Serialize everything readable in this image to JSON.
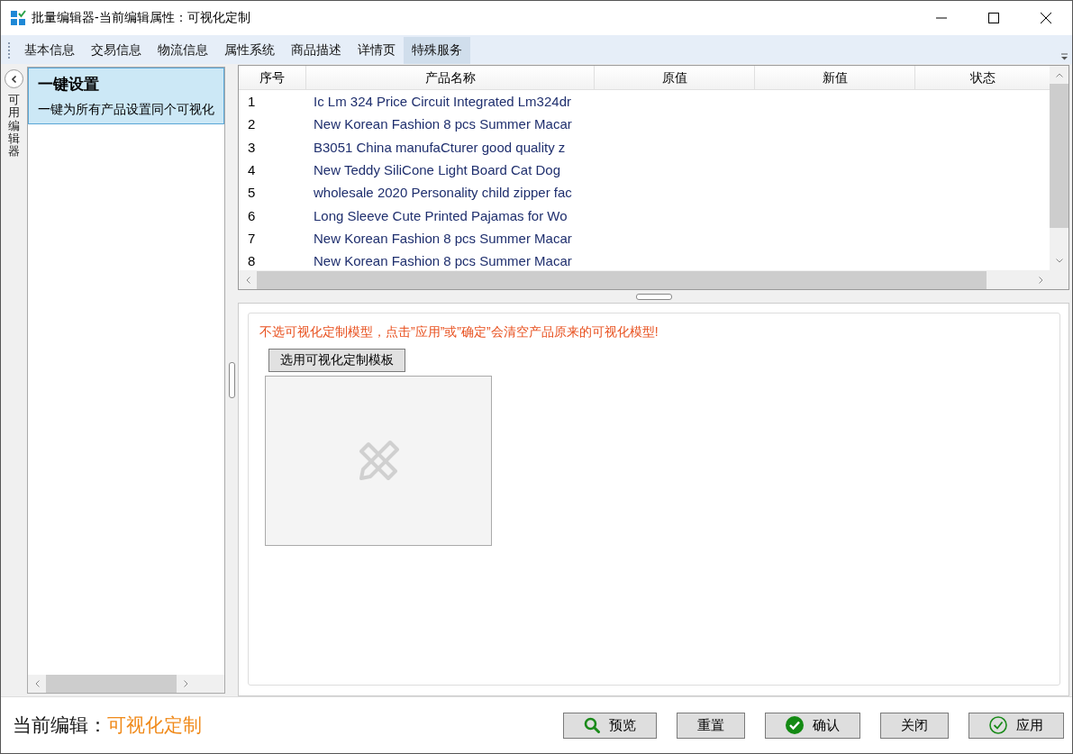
{
  "window": {
    "title": "批量编辑器-当前编辑属性：可视化定制"
  },
  "tabs": [
    {
      "label": "基本信息",
      "selected": false
    },
    {
      "label": "交易信息",
      "selected": false
    },
    {
      "label": "物流信息",
      "selected": false
    },
    {
      "label": "属性系统",
      "selected": false
    },
    {
      "label": "商品描述",
      "selected": false
    },
    {
      "label": "详情页",
      "selected": false
    },
    {
      "label": "特殊服务",
      "selected": true
    }
  ],
  "side_strip": {
    "label": "可用编辑器"
  },
  "editor_list": [
    {
      "title": "一键设置",
      "description": "一键为所有产品设置同个可视化",
      "selected": true
    }
  ],
  "table": {
    "columns": [
      "序号",
      "产品名称",
      "原值",
      "新值",
      "状态"
    ],
    "rows": [
      {
        "index": "1",
        "name": "Ic Lm 324 Price Circuit Integrated Lm324dr"
      },
      {
        "index": "2",
        "name": "New Korean Fashion 8 pcs Summer Macar"
      },
      {
        "index": "3",
        "name": "B3051 China manufaCturer good quality  z"
      },
      {
        "index": "4",
        "name": "New Teddy SiliCone Light Board Cat  Dog"
      },
      {
        "index": "5",
        "name": "wholesale 2020 Personality child zipper fac"
      },
      {
        "index": "6",
        "name": "Long Sleeve Cute Printed Pajamas for Wo"
      },
      {
        "index": "7",
        "name": "New Korean Fashion 8 pcs Summer Macar"
      },
      {
        "index": "8",
        "name": "New Korean Fashion 8 pcs Summer Macar"
      }
    ]
  },
  "panel": {
    "warning": "不选可视化定制模型，点击”应用”或”确定”会清空产品原来的可视化模型!",
    "choose_button": "选用可视化定制模板"
  },
  "footer": {
    "label": "当前编辑：",
    "value": "可视化定制",
    "buttons": [
      {
        "label": "预览",
        "kind": "search"
      },
      {
        "label": "重置",
        "kind": "plain"
      },
      {
        "label": "确认",
        "kind": "confirm"
      },
      {
        "label": "关闭",
        "kind": "plain"
      },
      {
        "label": "应用",
        "kind": "apply"
      }
    ]
  }
}
